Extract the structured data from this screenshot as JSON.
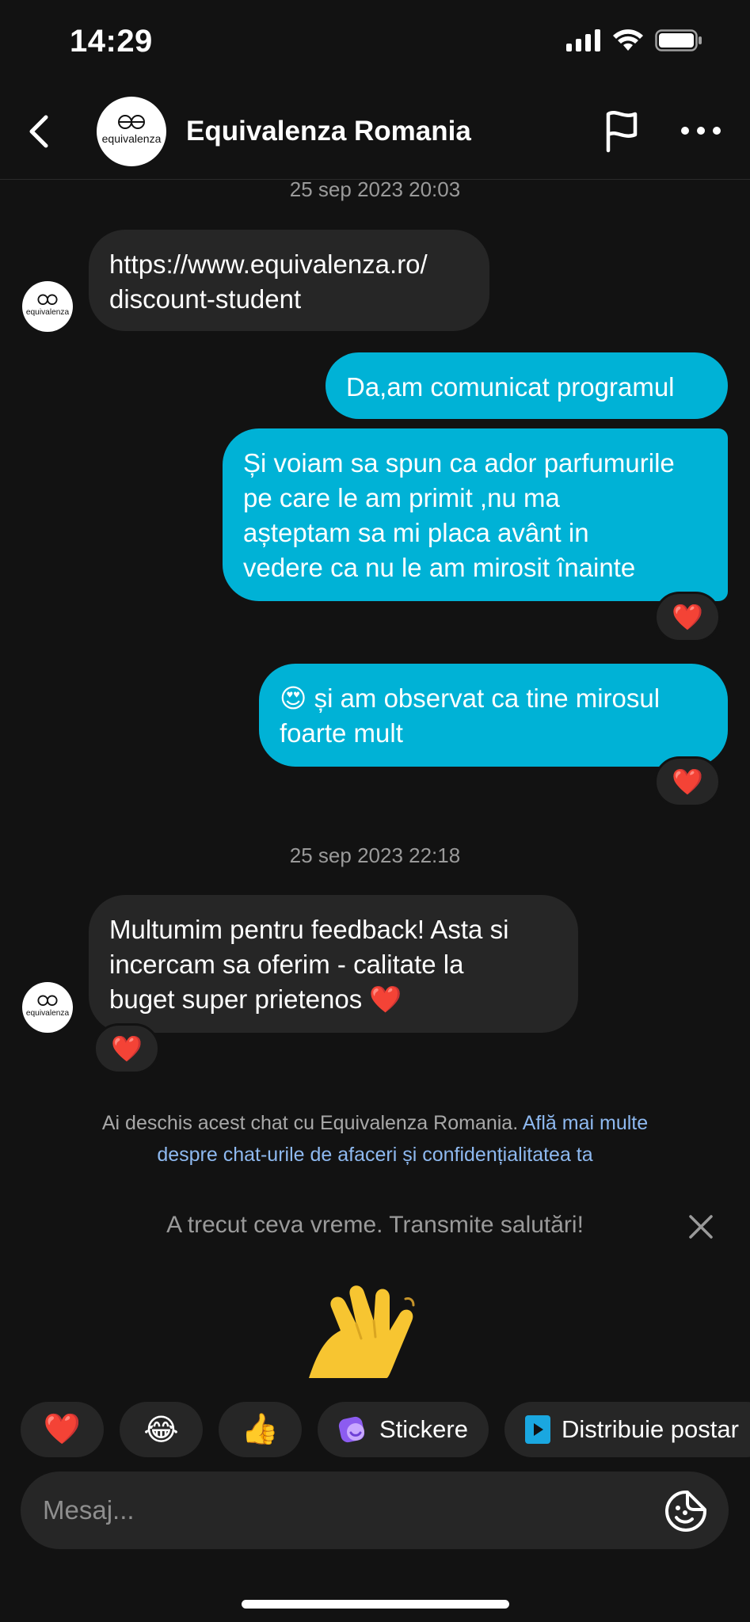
{
  "status_bar": {
    "time": "14:29"
  },
  "header": {
    "contact_name": "Equivalenza Romania",
    "avatar_text": "equivalenza",
    "icons": [
      "back-arrow-icon",
      "flag-icon",
      "more-icon"
    ]
  },
  "messages": [
    {
      "type": "timestamp",
      "text": "25 sep 2023 20:03"
    },
    {
      "type": "incoming",
      "lines": [
        "https://www.equivalenza.ro/",
        "discount-student"
      ]
    },
    {
      "type": "outgoing",
      "lines": [
        "Da,am comunicat programul"
      ]
    },
    {
      "type": "outgoing",
      "lines": [
        "Și voiam sa spun ca ador parfumurile",
        "pe care le am primit ,nu ma",
        "așteptam sa mi placa avânt in",
        "vedere ca nu le am mirosit înainte"
      ],
      "reaction": "❤️"
    },
    {
      "type": "outgoing",
      "lines": [
        "😍 și am observat ca tine mirosul",
        "foarte mult"
      ],
      "reaction": "❤️"
    },
    {
      "type": "timestamp",
      "text": "25 sep 2023 22:18"
    },
    {
      "type": "incoming",
      "lines": [
        "Multumim pentru feedback! Asta si",
        "incercam sa oferim - calitate la",
        "buget super prietenos ❤️"
      ],
      "reaction": "❤️"
    }
  ],
  "info": {
    "text": "Ai deschis acest chat cu Equivalenza Romania.",
    "link": "Află mai multe despre chat-urile de afaceri și confidențialitatea ta"
  },
  "nudge": {
    "text": "A trecut ceva vreme. Transmite salutări!",
    "emoji": "👋"
  },
  "quick_replies": {
    "heart": "❤️",
    "laugh": "😂",
    "thumbs": "👍",
    "stickers": "Stickere",
    "share": "Distribuie postar"
  },
  "composer": {
    "placeholder": "Mesaj..."
  },
  "colors": {
    "background": "#121212",
    "outgoing_bubble": "#00b2d6",
    "incoming_bubble": "#262626",
    "link": "#8eb9f0"
  }
}
